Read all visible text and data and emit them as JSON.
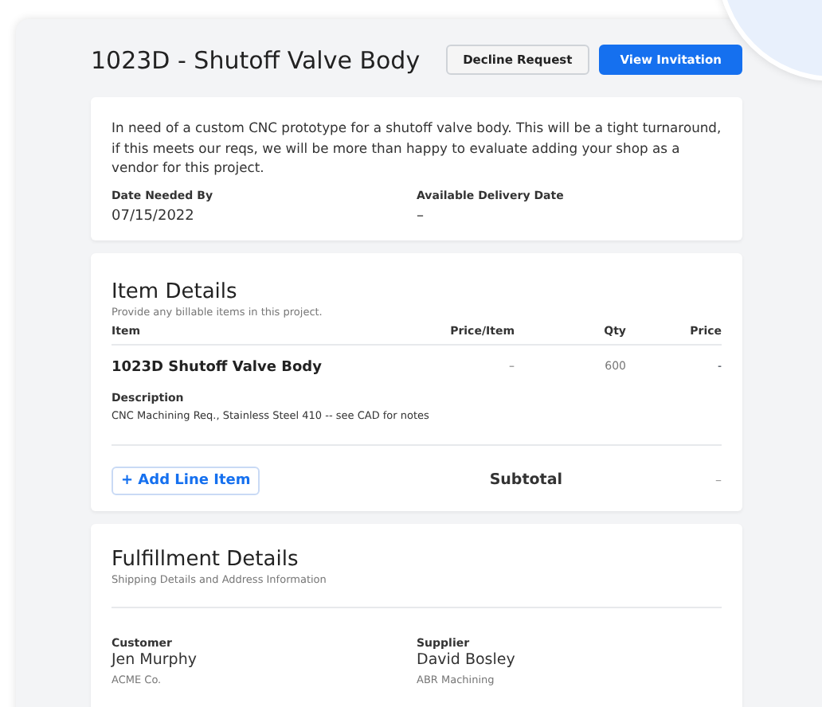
{
  "title": "1023D - Shutoff Valve Body",
  "buttons": [
    {
      "label": "Decline Request",
      "kind": "secondary"
    },
    {
      "label": "View Invitation",
      "kind": "primary"
    }
  ],
  "summary": {
    "description": "In need of a custom CNC prototype for a shutoff valve body. This will be a tight turnaround, if this meets our reqs, we will be more than happy to evaluate adding your shop as a vendor for this project.",
    "fields": [
      {
        "label": "Date Needed By",
        "value": "07/15/2022"
      },
      {
        "label": "Available Delivery Date",
        "value": "–"
      }
    ]
  },
  "item_details": {
    "heading": "Item Details",
    "subheading": "Provide any billable items in this project.",
    "columns": [
      "Item",
      "Price/Item",
      "Qty",
      "Price"
    ],
    "rows": [
      {
        "name": "1023D Shutoff Valve Body",
        "price_per_item": "–",
        "qty": "600",
        "price": "-",
        "description_label": "Description",
        "description": "CNC Machining Req., Stainless Steel 410 -- see CAD for notes"
      }
    ],
    "add_button": "+ Add Line Item",
    "subtotal_label": "Subtotal",
    "subtotal_value": "–"
  },
  "fulfillment": {
    "heading": "Fulfillment Details",
    "subheading": "Shipping Details and Address Information",
    "parties": [
      {
        "role": "Customer",
        "name": "Jen Murphy",
        "company": "ACME Co."
      },
      {
        "role": "Supplier",
        "name": "David Bosley",
        "company": "ABR Machining"
      }
    ]
  }
}
